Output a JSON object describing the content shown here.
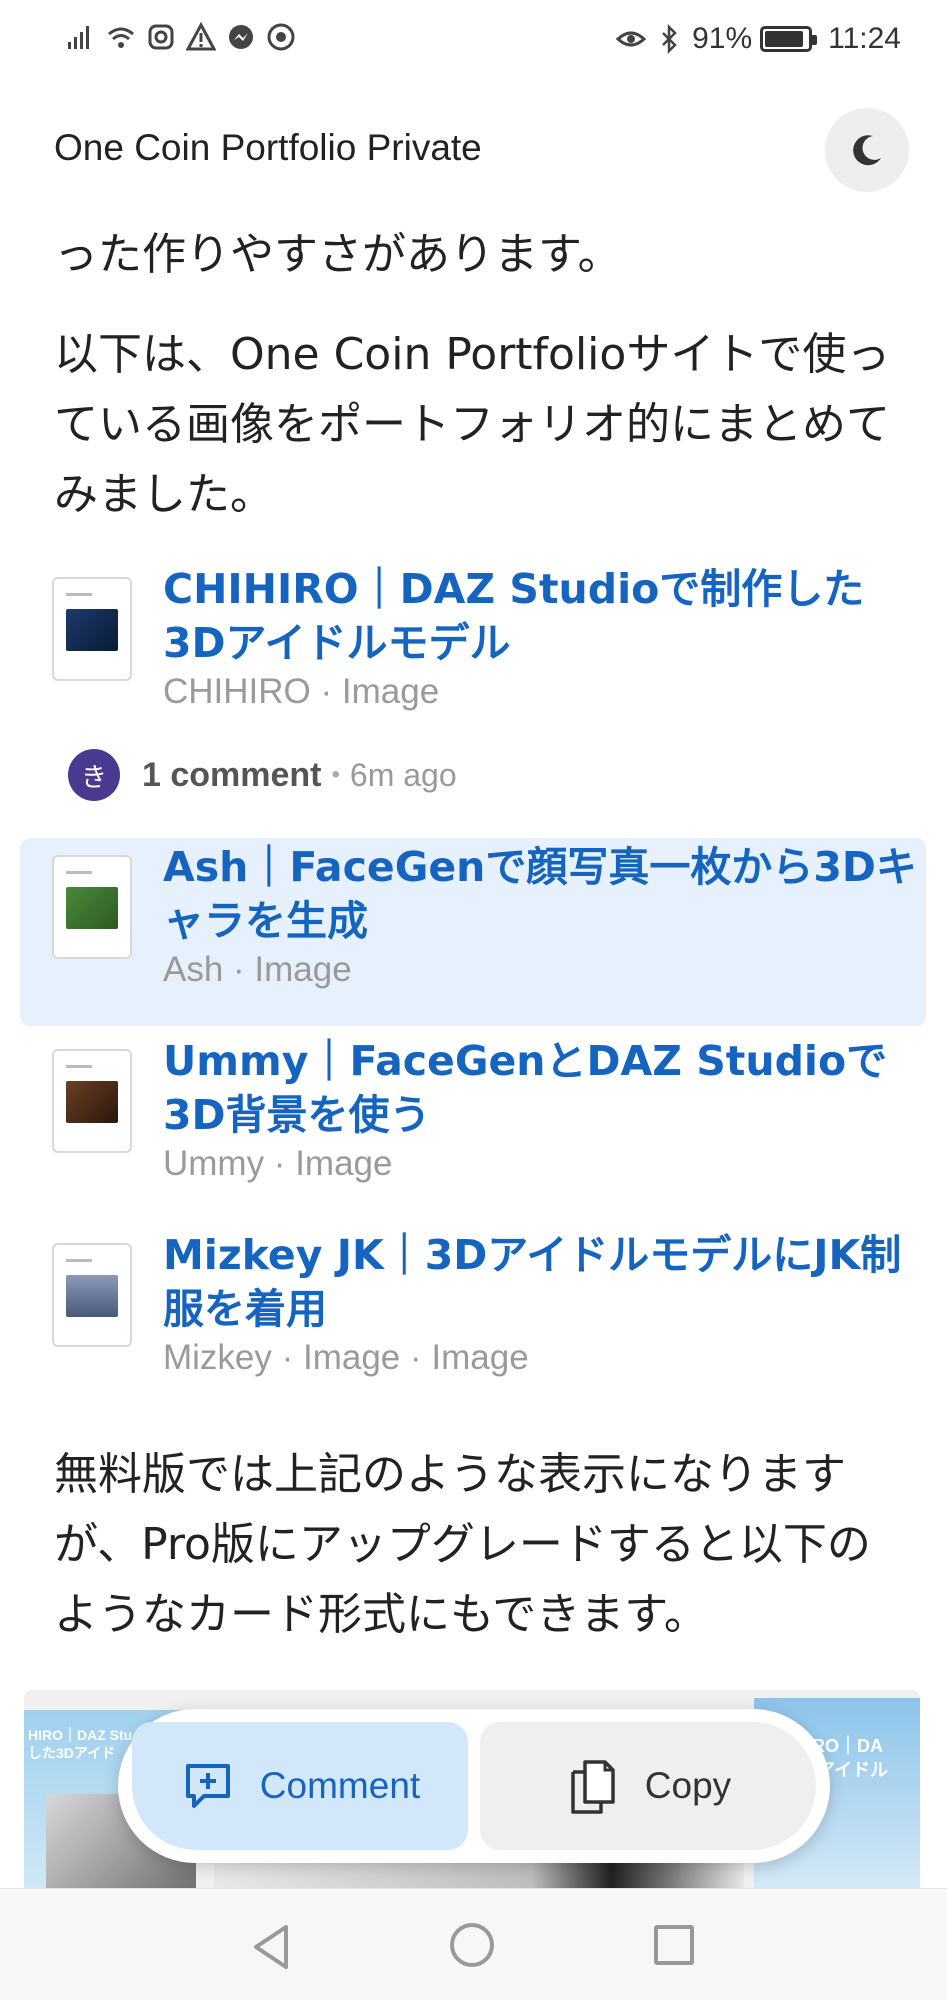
{
  "status_bar": {
    "battery": "91%",
    "battery_level": 0.91,
    "time": "11:24",
    "left_icons": [
      "signal-icon",
      "wifi-icon",
      "instagram-icon",
      "warning-icon",
      "messenger-icon",
      "chrome-icon"
    ],
    "right_icons": [
      "eye-icon",
      "bluetooth-icon"
    ]
  },
  "header": {
    "title": "One Coin Portfolio Private",
    "theme_icon": "moon-icon"
  },
  "content": {
    "para1": "った作りやすさがあります。",
    "para2": "以下は、One Coin Portfolioサイトで使っている画像をポートフォリオ的にまとめてみました。",
    "para3": "無料版では上記のような表示になりますが、Pro版にアップグレードすると以下のようなカード形式にもできます。"
  },
  "links": [
    {
      "title": "CHIHIRO｜DAZ Studioで制作した3Dアイドルモデル",
      "sub": "CHIHIRO · Image"
    },
    {
      "title": "Ash｜FaceGenで顔写真一枚から3Dキャラを生成",
      "sub": "Ash · Image"
    },
    {
      "title": "Ummy｜FaceGenとDAZ Studioで3D背景を使う",
      "sub": "Ummy · Image"
    },
    {
      "title": "Mizkey JK｜3DアイドルモデルにJK制服を着用",
      "sub": "Mizkey · Image · Image"
    }
  ],
  "comment": {
    "avatar_letter": "き",
    "count": "1 comment",
    "dot": "•",
    "time": "6m ago"
  },
  "preview": {
    "left_text": "HIRO｜DAZ Stu\nした3Dアイド",
    "right_text": "HIRO｜DA\n3Dアイドル"
  },
  "actions": {
    "comment_label": "Comment",
    "copy_label": "Copy"
  },
  "colors": {
    "link": "#1565c0",
    "active_bg": "#e6f1fd",
    "comment_btn_bg": "#d3e7fb",
    "avatar_bg": "#4a3a8f"
  }
}
